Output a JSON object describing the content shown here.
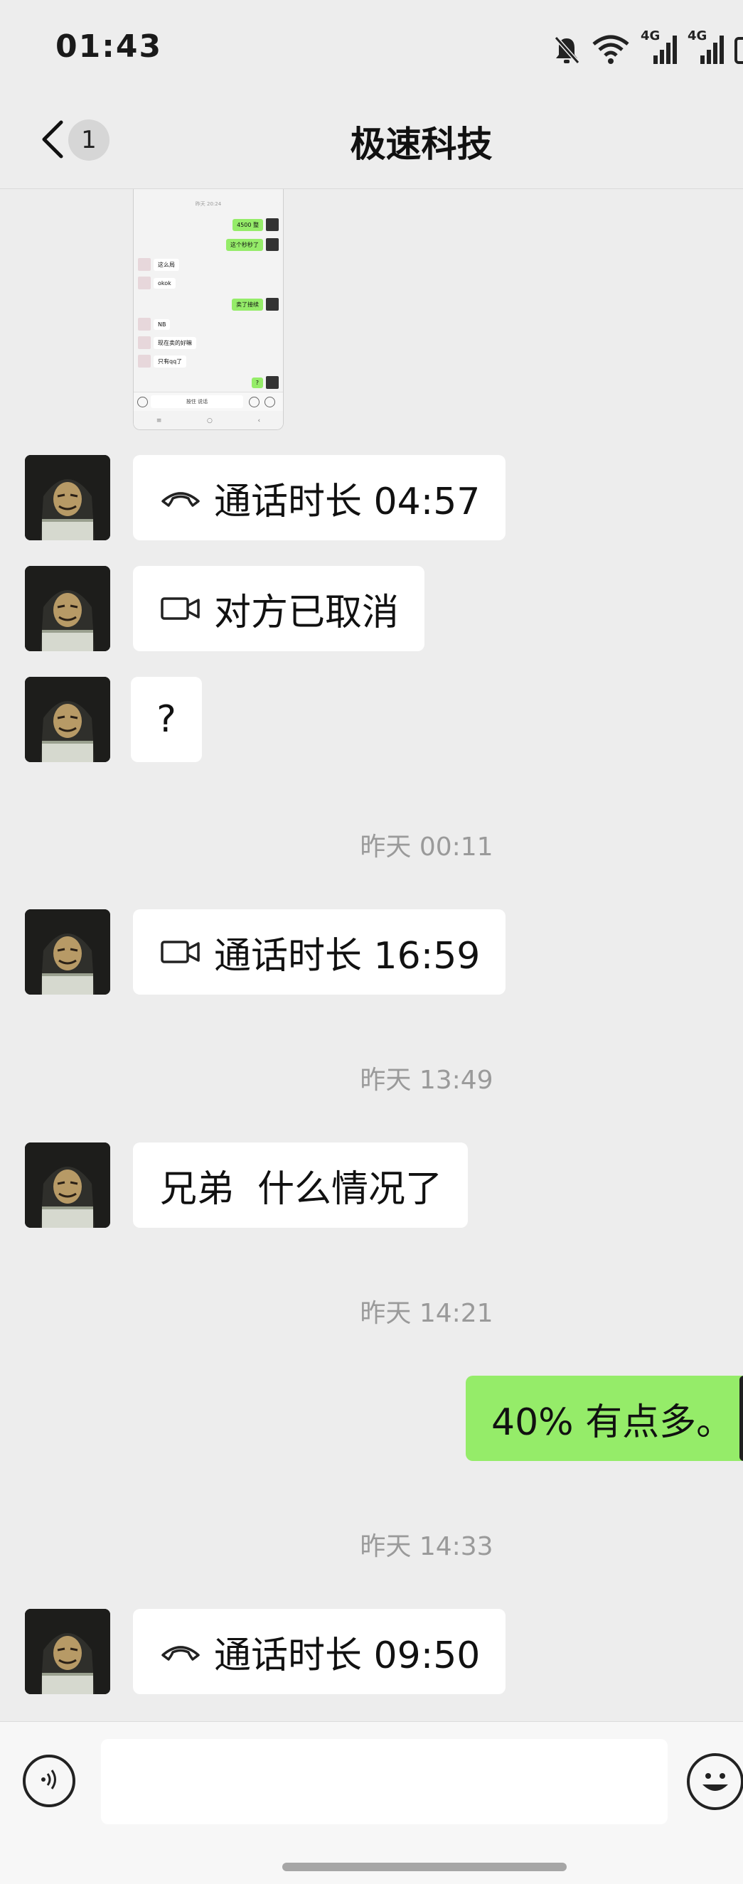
{
  "status_bar": {
    "time": "01:43",
    "net1": "4G",
    "net2": "4G"
  },
  "header": {
    "title": "极速科技",
    "unread_count": "1"
  },
  "thumbnail": {
    "timestamp": "昨天 20:24",
    "rows": [
      {
        "side": "r",
        "text": "4500 整"
      },
      {
        "side": "r",
        "text": "这个秒秒了"
      },
      {
        "side": "l",
        "text": "这么局"
      },
      {
        "side": "l",
        "text": "okok"
      },
      {
        "side": "r",
        "text": "卖了接续"
      },
      {
        "side": "l",
        "text": "NB"
      },
      {
        "side": "l",
        "text": "现在卖的好嘛"
      },
      {
        "side": "l",
        "text": "只有qq了"
      },
      {
        "side": "r",
        "text": "?"
      }
    ],
    "input_text": "按住 说话"
  },
  "messages": [
    {
      "type": "voice_call",
      "icon": "phone-call-icon",
      "text": "通话时长 04:57"
    },
    {
      "type": "video_call",
      "icon": "video-call-icon",
      "text": "对方已取消"
    },
    {
      "type": "text",
      "text": "?"
    },
    {
      "type": "timestamp",
      "text": "昨天 00:11"
    },
    {
      "type": "video_call",
      "icon": "video-call-icon",
      "text": "通话时长 16:59"
    },
    {
      "type": "timestamp",
      "text": "昨天 13:49"
    },
    {
      "type": "text",
      "text": "兄弟  什么情况了"
    },
    {
      "type": "timestamp",
      "text": "昨天 14:21"
    },
    {
      "type": "outgoing_text",
      "text": "40% 有点多。"
    },
    {
      "type": "timestamp",
      "text": "昨天 14:33"
    },
    {
      "type": "voice_call",
      "icon": "phone-call-icon",
      "text": "通话时长 09:50"
    }
  ],
  "colors": {
    "background": "#ededed",
    "outgoing_bubble": "#95ec69",
    "incoming_bubble": "#ffffff",
    "timestamp": "#9a9a9a"
  }
}
